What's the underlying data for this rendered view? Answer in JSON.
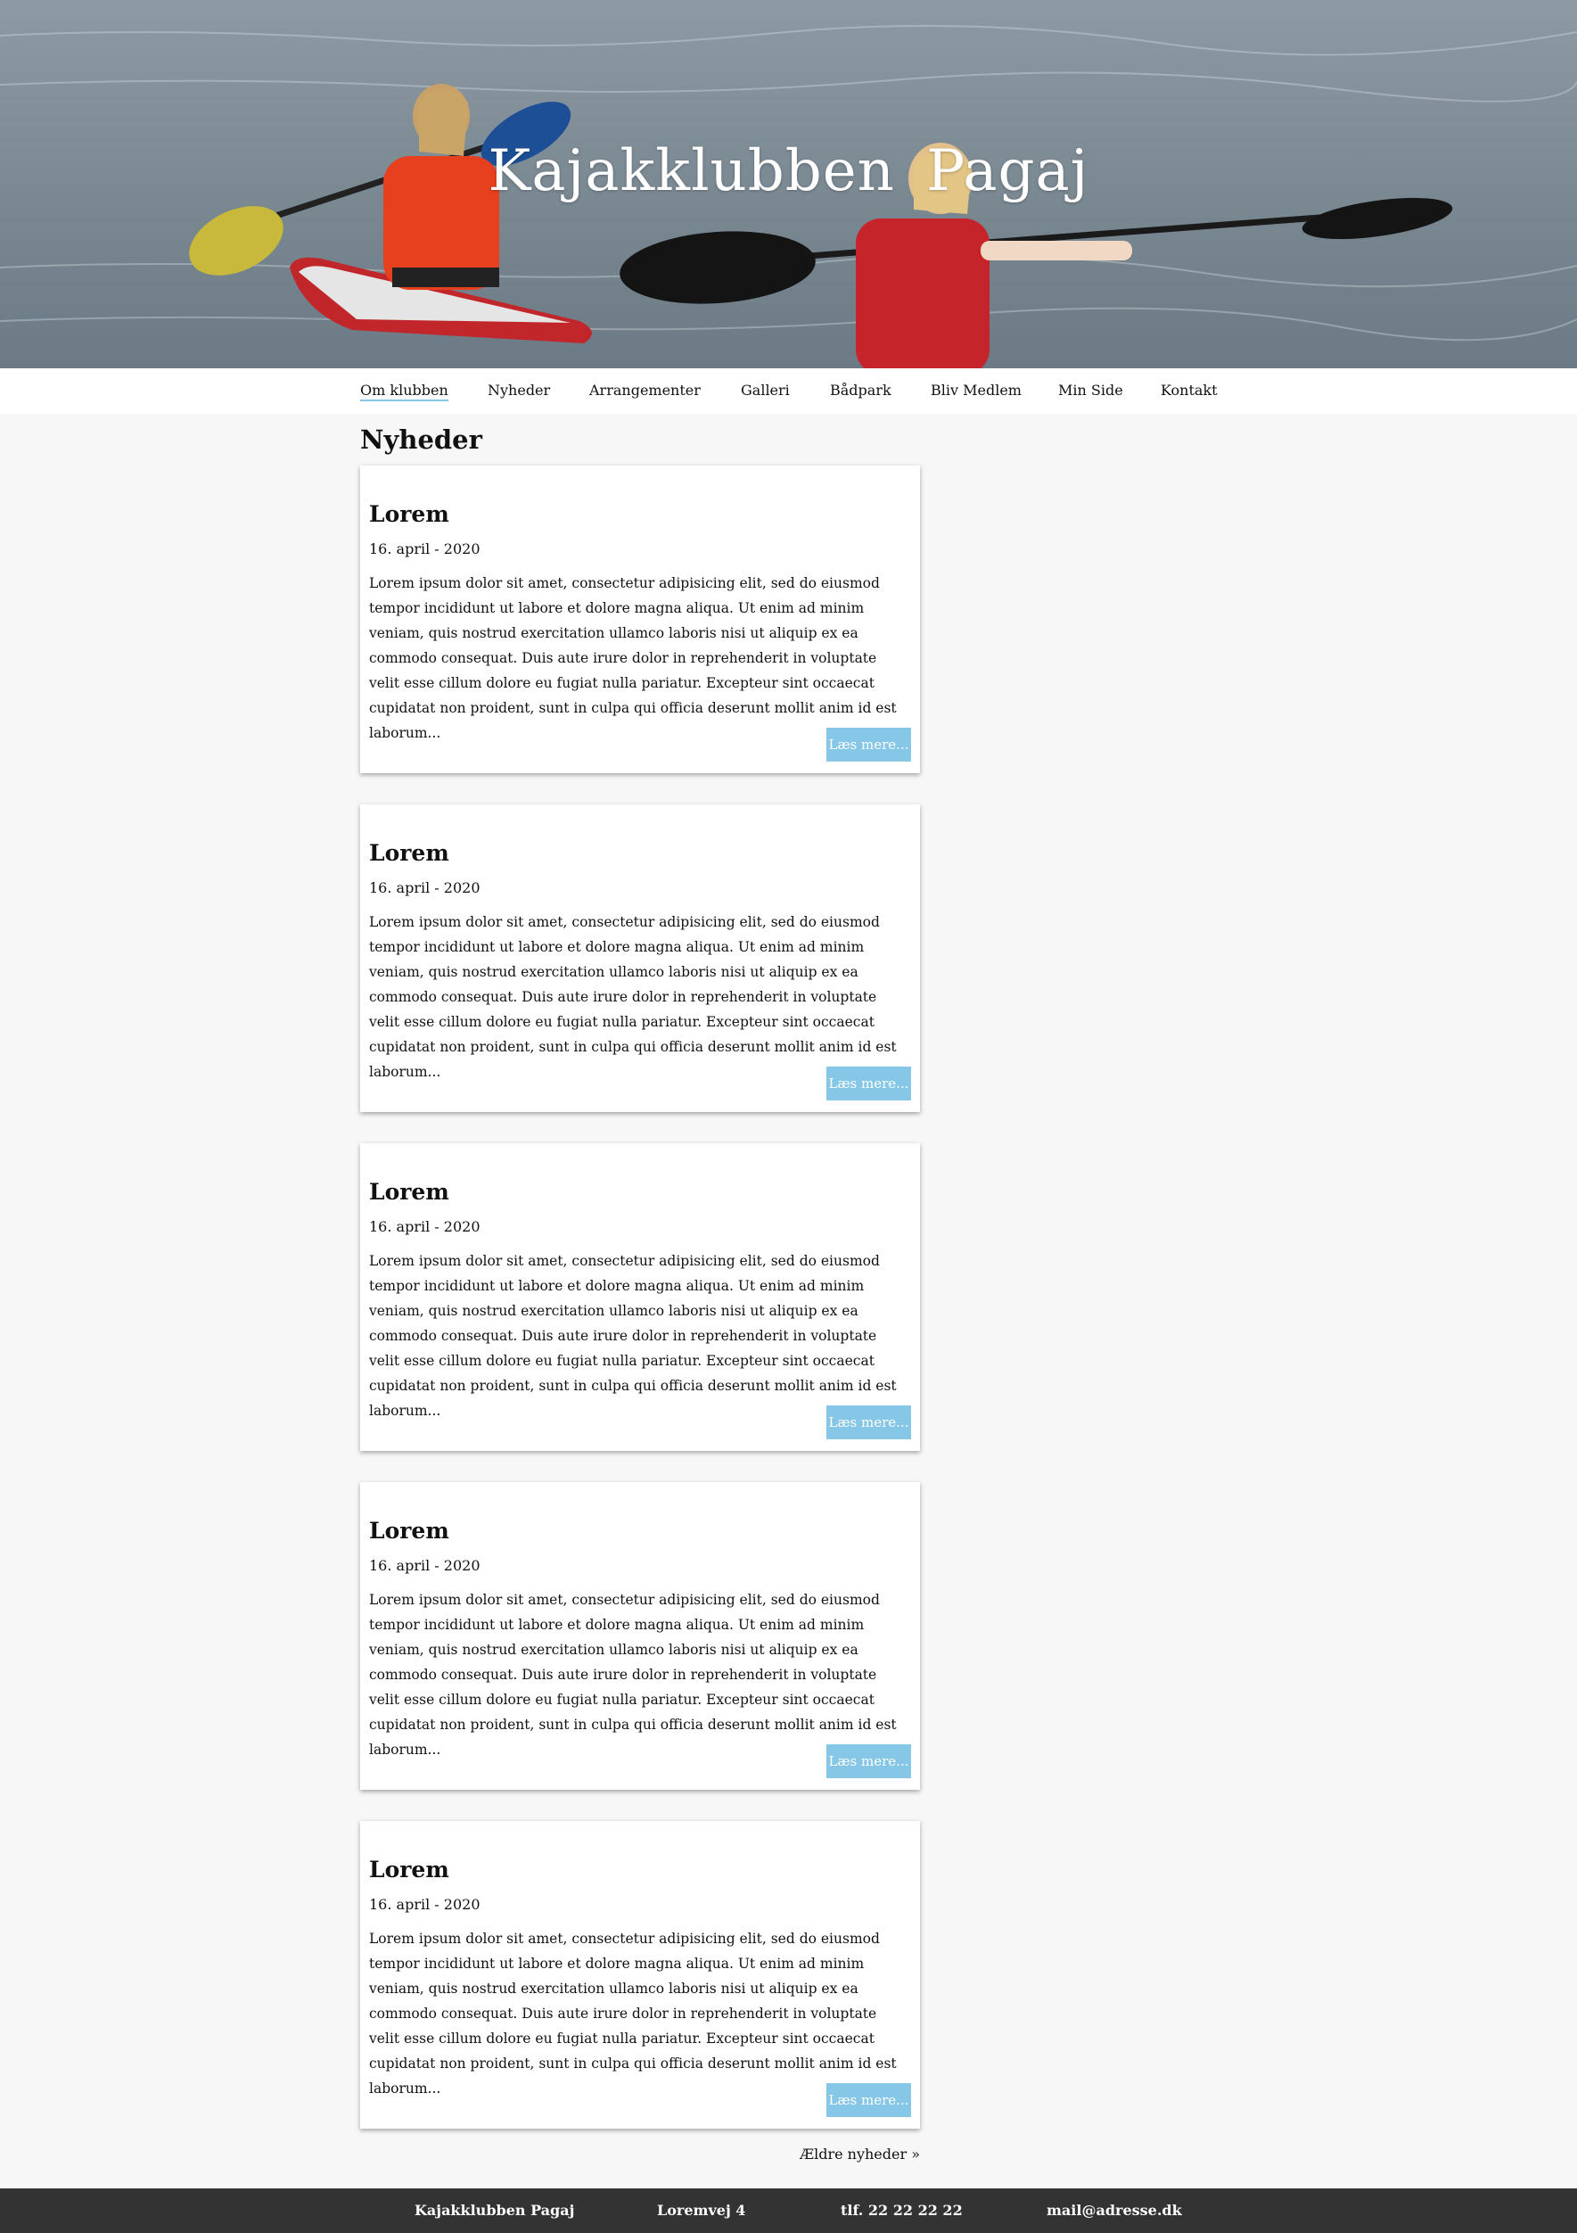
{
  "site": {
    "title": "Kajakklubben  Pagaj"
  },
  "nav": {
    "items": [
      {
        "label": "Om klubben",
        "active": true
      },
      {
        "label": "Nyheder"
      },
      {
        "label": "Arrangementer"
      },
      {
        "label": "Galleri"
      },
      {
        "label": "Bådpark"
      },
      {
        "label": "Bliv Medlem"
      },
      {
        "label": "Min Side"
      },
      {
        "label": "Kontakt"
      }
    ],
    "accent_color": "#86c6e6"
  },
  "main": {
    "heading": "Nyheder",
    "articles": [
      {
        "title": "Lorem",
        "date": "16. april - 2020",
        "text": "Lorem ipsum dolor sit amet, consectetur adipisicing elit, sed do eiusmod tempor incididunt ut labore et dolore magna aliqua. Ut enim ad minim veniam, quis nostrud exercitation ullamco laboris nisi ut aliquip ex ea commodo consequat. Duis aute irure dolor in reprehenderit in voluptate velit esse cillum dolore eu fugiat nulla pariatur. Excepteur sint occaecat cupidatat non proident, sunt in culpa qui officia deserunt mollit anim id est laborum...",
        "button": "Læs mere..."
      },
      {
        "title": "Lorem",
        "date": "16. april - 2020",
        "text": "Lorem ipsum dolor sit amet, consectetur adipisicing elit, sed do eiusmod tempor incididunt ut labore et dolore magna aliqua. Ut enim ad minim veniam, quis nostrud exercitation ullamco laboris nisi ut aliquip ex ea commodo consequat. Duis aute irure dolor in reprehenderit in voluptate velit esse cillum dolore eu fugiat nulla pariatur. Excepteur sint occaecat cupidatat non proident, sunt in culpa qui officia deserunt mollit anim id est laborum...",
        "button": "Læs mere..."
      },
      {
        "title": "Lorem",
        "date": "16. april - 2020",
        "text": "Lorem ipsum dolor sit amet, consectetur adipisicing elit, sed do eiusmod tempor incididunt ut labore et dolore magna aliqua. Ut enim ad minim veniam, quis nostrud exercitation ullamco laboris nisi ut aliquip ex ea commodo consequat. Duis aute irure dolor in reprehenderit in voluptate velit esse cillum dolore eu fugiat nulla pariatur. Excepteur sint occaecat cupidatat non proident, sunt in culpa qui officia deserunt mollit anim id est laborum...",
        "button": "Læs mere..."
      },
      {
        "title": "Lorem",
        "date": "16. april - 2020",
        "text": "Lorem ipsum dolor sit amet, consectetur adipisicing elit, sed do eiusmod tempor incididunt ut labore et dolore magna aliqua. Ut enim ad minim veniam, quis nostrud exercitation ullamco laboris nisi ut aliquip ex ea commodo consequat. Duis aute irure dolor in reprehenderit in voluptate velit esse cillum dolore eu fugiat nulla pariatur. Excepteur sint occaecat cupidatat non proident, sunt in culpa qui officia deserunt mollit anim id est laborum...",
        "button": "Læs mere..."
      },
      {
        "title": "Lorem",
        "date": "16. april - 2020",
        "text": "Lorem ipsum dolor sit amet, consectetur adipisicing elit, sed do eiusmod tempor incididunt ut labore et dolore magna aliqua. Ut enim ad minim veniam, quis nostrud exercitation ullamco laboris nisi ut aliquip ex ea commodo consequat. Duis aute irure dolor in reprehenderit in voluptate velit esse cillum dolore eu fugiat nulla pariatur. Excepteur sint occaecat cupidatat non proident, sunt in culpa qui officia deserunt mollit anim id est laborum...",
        "button": "Læs mere..."
      }
    ],
    "older_link": "Ældre nyheder »"
  },
  "footer": {
    "name": "Kajakklubben Pagaj",
    "address": "Loremvej 4",
    "phone": "tlf. 22 22 22 22",
    "email": "mail@adresse.dk"
  }
}
